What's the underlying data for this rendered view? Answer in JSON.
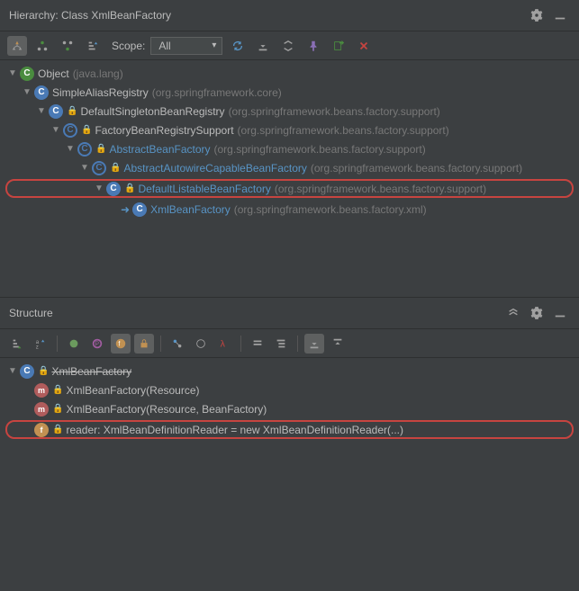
{
  "hierarchy": {
    "title": "Hierarchy: Class XmlBeanFactory",
    "scope_label": "Scope:",
    "scope_value": "All",
    "tree": [
      {
        "indent": 0,
        "icon": "c-class",
        "name": "Object",
        "pkg": "(java.lang)",
        "arrow": true
      },
      {
        "indent": 1,
        "icon": "c-blue",
        "name": "SimpleAliasRegistry",
        "pkg": "(org.springframework.core)",
        "arrow": true
      },
      {
        "indent": 2,
        "icon": "c-blue",
        "name": "DefaultSingletonBeanRegistry",
        "pkg": "(org.springframework.beans.factory.support)",
        "arrow": true,
        "lock": true
      },
      {
        "indent": 3,
        "icon": "c-abstract",
        "name": "FactoryBeanRegistrySupport",
        "pkg": "(org.springframework.beans.factory.support)",
        "arrow": true,
        "lock": true
      },
      {
        "indent": 4,
        "icon": "c-abstract",
        "name": "AbstractBeanFactory",
        "pkg": "(org.springframework.beans.factory.support)",
        "arrow": true,
        "lock": true,
        "link": true
      },
      {
        "indent": 5,
        "icon": "c-abstract",
        "name": "AbstractAutowireCapableBeanFactory",
        "pkg": "(org.springframework.beans.factory.support)",
        "arrow": true,
        "lock": true,
        "link": true
      },
      {
        "indent": 6,
        "icon": "c-blue",
        "name": "DefaultListableBeanFactory",
        "pkg": "(org.springframework.beans.factory.support)",
        "arrow": true,
        "lock": true,
        "link": true,
        "hl": true
      },
      {
        "indent": 7,
        "icon": "c-blue",
        "name": "XmlBeanFactory",
        "pkg": "(org.springframework.beans.factory.xml)",
        "arrow": false,
        "nav": true,
        "link": true
      }
    ]
  },
  "structure": {
    "title": "Structure",
    "tree": [
      {
        "indent": 0,
        "icon": "c-blue",
        "name": "XmlBeanFactory",
        "arrow": true,
        "lock": true,
        "strike": true
      },
      {
        "indent": 1,
        "icon": "c-method",
        "iconText": "m",
        "name": "XmlBeanFactory(Resource)",
        "arrow": false,
        "lock": true
      },
      {
        "indent": 1,
        "icon": "c-method",
        "iconText": "m",
        "name": "XmlBeanFactory(Resource, BeanFactory)",
        "arrow": false,
        "lock": true
      },
      {
        "indent": 1,
        "icon": "c-field",
        "iconText": "f",
        "name": "reader: XmlBeanDefinitionReader = new XmlBeanDefinitionReader(...)",
        "arrow": false,
        "lock": true,
        "hl": true
      }
    ]
  }
}
